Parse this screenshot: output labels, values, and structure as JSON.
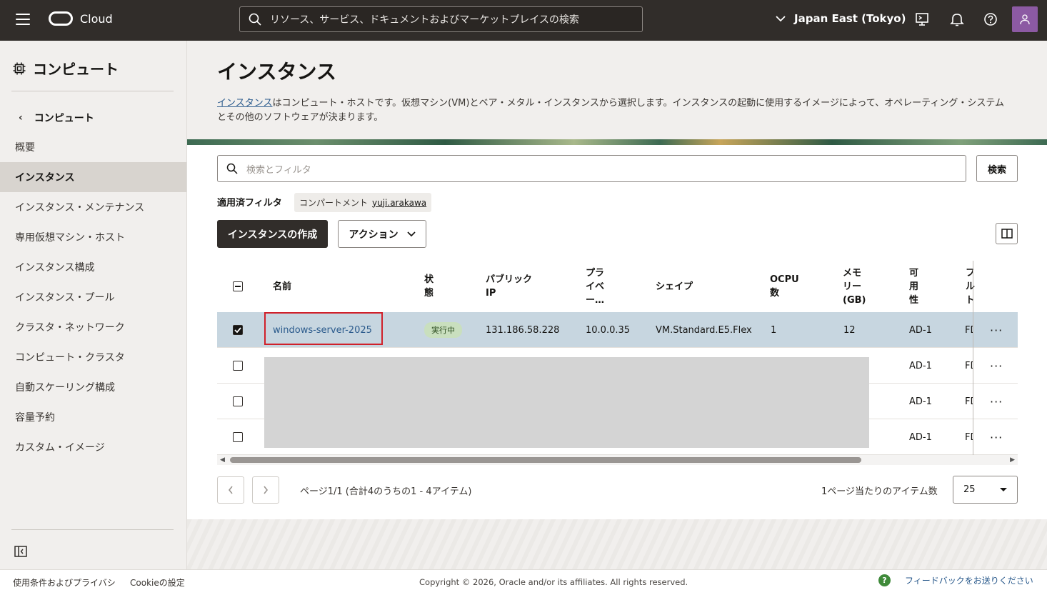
{
  "header": {
    "brand": "Cloud",
    "search_placeholder": "リソース、サービス、ドキュメントおよびマーケットプレイスの検索",
    "region": "Japan East (Tokyo)"
  },
  "sidebar": {
    "title": "コンピュート",
    "back_label": "コンピュート",
    "items": [
      {
        "label": "概要"
      },
      {
        "label": "インスタンス"
      },
      {
        "label": "インスタンス・メンテナンス"
      },
      {
        "label": "専用仮想マシン・ホスト"
      },
      {
        "label": "インスタンス構成"
      },
      {
        "label": "インスタンス・プール"
      },
      {
        "label": "クラスタ・ネットワーク"
      },
      {
        "label": "コンピュート・クラスタ"
      },
      {
        "label": "自動スケーリング構成"
      },
      {
        "label": "容量予約"
      },
      {
        "label": "カスタム・イメージ"
      }
    ]
  },
  "main": {
    "title": "インスタンス",
    "desc_link": "インスタンス",
    "desc_text": "はコンピュート・ホストです。仮想マシン(VM)とベア・メタル・インスタンスから選択します。インスタンスの起動に使用するイメージによって、オペレーティング・システムとその他のソフトウェアが決まります。",
    "filter_placeholder": "検索とフィルタ",
    "search_button": "検索",
    "applied_filters_label": "適用済フィルタ",
    "chip_key": "コンパートメント",
    "chip_value": "yuji.arakawa",
    "create_button": "インスタンスの作成",
    "action_button": "アクション"
  },
  "table": {
    "headers": {
      "name": "名前",
      "state": "状\n態",
      "public_ip": "パブリック\nIP",
      "private_ip": "プラ\nイベ\nー…",
      "shape": "シェイプ",
      "ocpu": "OCPU\n数",
      "memory": "メモ\nリー\n(GB)",
      "ad": "可\n用\n性",
      "fd": "フ\nル\nト"
    },
    "rows": [
      {
        "name": "windows-server-2025",
        "state": "実行中",
        "public_ip": "131.186.58.228",
        "private_ip": "10.0.0.35",
        "shape": "VM.Standard.E5.Flex",
        "ocpu": "1",
        "memory": "12",
        "ad": "AD-1",
        "fd": "FD",
        "more": "···"
      },
      {
        "ad": "AD-1",
        "fd": "FD",
        "more": "···"
      },
      {
        "ad": "AD-1",
        "fd": "FD",
        "more": "···"
      },
      {
        "ad": "AD-1",
        "fd": "FD",
        "more": "···"
      }
    ]
  },
  "pagination": {
    "text": "ページ1/1 (合計4のうちの1 - 4アイテム)",
    "per_page_label": "1ページ当たりのアイテム数",
    "per_page_value": "25"
  },
  "footer": {
    "terms": "使用条件およびプライバシ",
    "cookie": "Cookieの設定",
    "copyright": "Copyright © 2026, Oracle and/or its affiliates. All rights reserved.",
    "feedback": "フィードバックをお送りください"
  }
}
